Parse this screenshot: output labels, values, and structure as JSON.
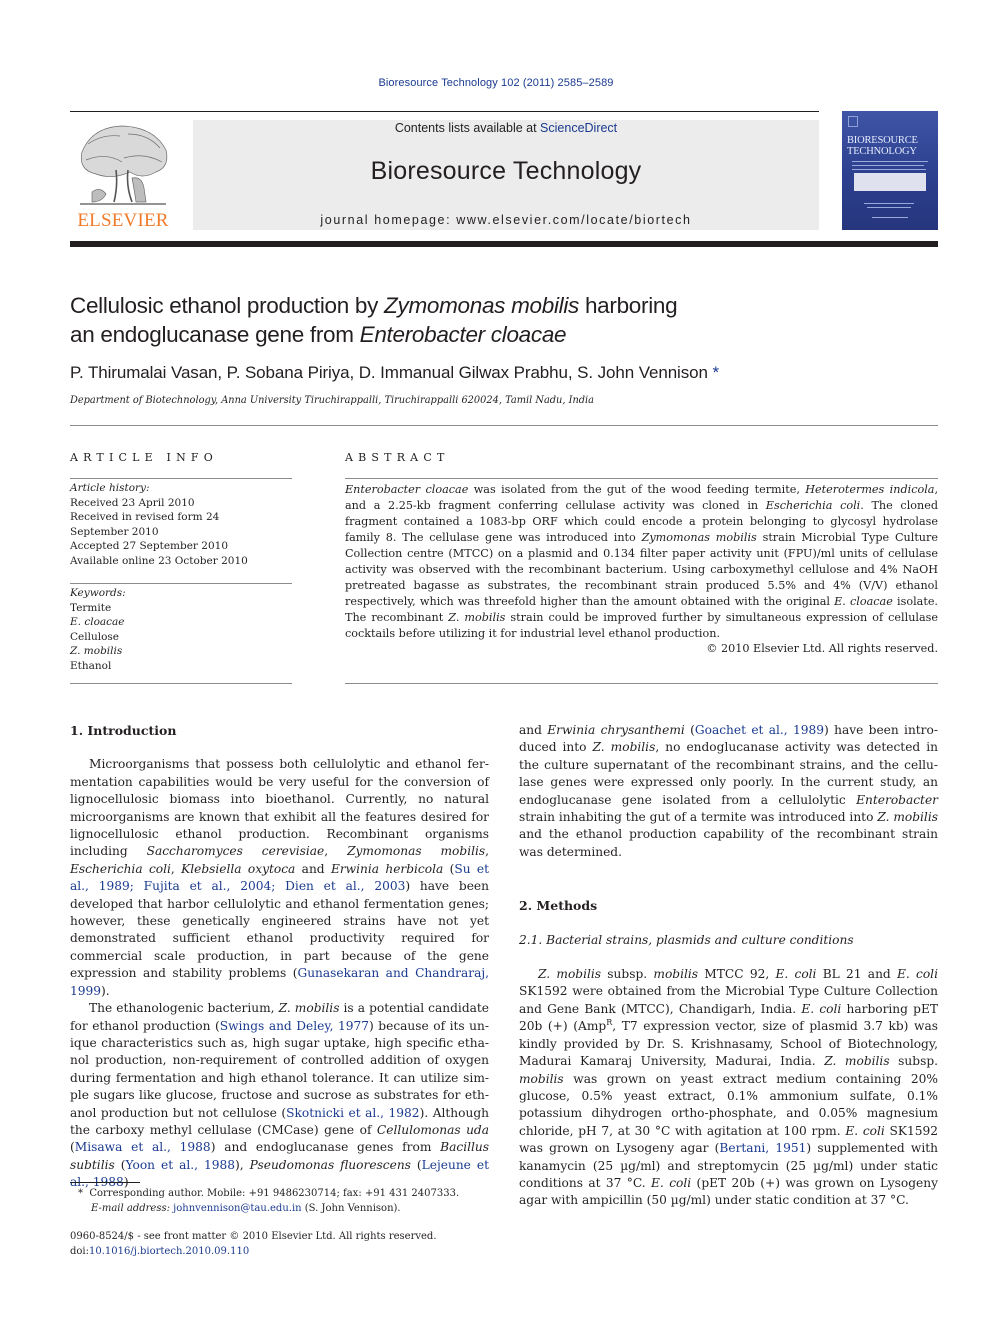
{
  "header": {
    "citation": "Bioresource Technology 102 (2011) 2585–2589",
    "contents_prefix": "Contents lists available at ",
    "contents_link": "ScienceDirect",
    "journal_title": "Bioresource Technology",
    "homepage": "journal homepage: www.elsevier.com/locate/biortech",
    "publisher_logo_text": "ELSEVIER",
    "cover_title_line1": "BIORESOURCE",
    "cover_title_line2": "TECHNOLOGY",
    "colors": {
      "elsevier_orange": "#f07b2a",
      "link_blue": "#1a3a8f",
      "cover_blue": "#2c3f8e",
      "banner_gray": "#ececec"
    }
  },
  "article": {
    "title_part1": "Cellulosic ethanol production by ",
    "title_italic1": "Zymomonas mobilis",
    "title_part2": " harboring",
    "title_line2_part1": "an endoglucanase gene from ",
    "title_italic2": "Enterobacter cloacae",
    "authors": "P. Thirumalai Vasan, P. Sobana Piriya, D. Immanual Gilwax Prabhu, S. John Vennison",
    "author_marker": "*",
    "affiliation": "Department of Biotechnology, Anna University Tiruchirappalli, Tiruchirappalli 620024, Tamil Nadu, India"
  },
  "article_info": {
    "heading": "ARTICLE INFO",
    "history_label": "Article history:",
    "history": [
      "Received 23 April 2010",
      "Received in revised form 24 September 2010",
      "Accepted 27 September 2010",
      "Available online 23 October 2010"
    ],
    "keywords_label": "Keywords:",
    "keywords": [
      {
        "text": "Termite",
        "italic": false
      },
      {
        "text": "E. cloacae",
        "italic": true
      },
      {
        "text": "Cellulose",
        "italic": false
      },
      {
        "text": "Z. mobilis",
        "italic": true
      },
      {
        "text": "Ethanol",
        "italic": false
      }
    ]
  },
  "abstract": {
    "heading": "ABSTRACT",
    "segments": [
      {
        "t": "Enterobacter cloacae",
        "i": true
      },
      {
        "t": " was isolated from the gut of the wood feeding termite, "
      },
      {
        "t": "Heterotermes indicola",
        "i": true
      },
      {
        "t": ", and a 2.25-kb fragment conferring cellulase activity was cloned in "
      },
      {
        "t": "Escherichia coli",
        "i": true
      },
      {
        "t": ". The cloned fragment con­tained a 1083-bp ORF which could encode a protein belonging to glycosyl hydrolase family 8. The cellu­lase gene was introduced into "
      },
      {
        "t": "Zymomonas mobilis",
        "i": true
      },
      {
        "t": " strain Microbial Type Culture Collection centre (MTCC) on a plasmid and 0.134 filter paper activity unit (FPU)/ml units of cellulase activity was observed with the recombinant bacterium. Using carboxymethyl cellulose and 4% NaOH pretreated bagasse as substrates, the recombinant strain produced 5.5% and 4% (V/V) ethanol respectively, which was threefold higher than the amount obtained with the original "
      },
      {
        "t": "E. cloacae",
        "i": true
      },
      {
        "t": " isolate. The recombinant "
      },
      {
        "t": "Z. mobilis",
        "i": true
      },
      {
        "t": " strain could be improved further by simultaneous expression of cellulase cocktails before utilizing it for industrial level ethanol production."
      }
    ],
    "copyright": "© 2010 Elsevier Ltd. All rights reserved."
  },
  "body": {
    "intro_heading": "1. Introduction",
    "intro_p1": [
      {
        "t": "Microorganisms that possess both cellulolytic and ethanol fer­mentation capabilities would be very useful for the conversion of lignocellulosic biomass into bioethanol. Currently, no natural microorganisms are known that exhibit all the features desired for lignocellulosic ethanol production. Recombinant organisms including "
      },
      {
        "t": "Saccharomyces cerevisiae",
        "i": true
      },
      {
        "t": ", "
      },
      {
        "t": "Zymomonas mobilis",
        "i": true
      },
      {
        "t": ", "
      },
      {
        "t": "Escherichia coli",
        "i": true
      },
      {
        "t": ", "
      },
      {
        "t": "Klebsiella oxytoca",
        "i": true
      },
      {
        "t": " and "
      },
      {
        "t": "Erwinia herbicola",
        "i": true
      },
      {
        "t": " ("
      },
      {
        "t": "Su et al., 1989; Fujita et al., 2004; Dien et al., 2003",
        "l": true
      },
      {
        "t": ") have been developed that harbor cel­lulolytic and ethanol fermentation genes; however, these geneti­cally engineered strains have not yet demonstrated sufficient ethanol productivity required for commercial scale production, in part because of the gene expression and stability problems ("
      },
      {
        "t": "Gun­asekaran and Chandraraj, 1999",
        "l": true
      },
      {
        "t": ")."
      }
    ],
    "intro_p2": [
      {
        "t": "The ethanologenic bacterium, "
      },
      {
        "t": "Z. mobilis",
        "i": true
      },
      {
        "t": " is a potential candidate for ethanol production ("
      },
      {
        "t": "Swings and Deley, 1977",
        "l": true
      },
      {
        "t": ") because of its un­ique characteristics such as, high sugar uptake, high specific etha­nol production, non-requirement of controlled addition of oxygen during fermentation and high ethanol tolerance. It can utilize sim­ple sugars like glucose, fructose and sucrose as substrates for eth­anol production but not cellulose ("
      },
      {
        "t": "Skotnicki et al., 1982",
        "l": true
      },
      {
        "t": "). Although the carboxy methyl cellulase (CMCase) gene of "
      },
      {
        "t": "Cellulomonas uda",
        "i": true
      },
      {
        "t": " ("
      },
      {
        "t": "Misawa et al., 1988",
        "l": true
      },
      {
        "t": ") and endoglucanase genes from "
      },
      {
        "t": "Bacillus subtil­is",
        "i": true
      },
      {
        "t": " ("
      },
      {
        "t": "Yoon et al., 1988",
        "l": true
      },
      {
        "t": "), "
      },
      {
        "t": "Pseudomonas fluorescens",
        "i": true
      },
      {
        "t": " ("
      },
      {
        "t": "Lejeune et al., 1988",
        "l": true
      },
      {
        "t": ") and "
      },
      {
        "t": "Erwinia chrysanthemi",
        "i": true
      },
      {
        "t": " ("
      },
      {
        "t": "Goachet et al., 1989",
        "l": true
      },
      {
        "t": ") have been intro­duced into "
      },
      {
        "t": "Z. mobilis",
        "i": true
      },
      {
        "t": ", no endoglucanase activity was detected in the culture supernatant of the recombinant strains, and the cellu­lase genes were expressed only poorly. In the current study, an endoglucanase gene isolated from a cellulolytic "
      },
      {
        "t": "Enterobacter",
        "i": true
      },
      {
        "t": " strain inhabiting the gut of a termite was introduced into "
      },
      {
        "t": "Z. mobilis",
        "i": true
      },
      {
        "t": " and the ethanol production capability of the recombinant strain was determined."
      }
    ],
    "methods_heading": "2. Methods",
    "methods_sub_heading": "2.1. Bacterial strains, plasmids and culture conditions",
    "methods_p1": [
      {
        "t": "Z. mobilis",
        "i": true
      },
      {
        "t": " subsp. "
      },
      {
        "t": "mobilis",
        "i": true
      },
      {
        "t": " MTCC 92, "
      },
      {
        "t": "E. coli",
        "i": true
      },
      {
        "t": " BL 21 and "
      },
      {
        "t": "E. coli",
        "i": true
      },
      {
        "t": " SK1592 were obtained from the Microbial Type Culture Collection and Gene Bank (MTCC), Chandigarh, India. "
      },
      {
        "t": "E. coli",
        "i": true
      },
      {
        "t": " harboring pET 20b (+) (Amp"
      },
      {
        "t": "R",
        "s": true
      },
      {
        "t": ", T7 expression vector, size of plasmid 3.7 kb) was kindly provided by Dr. S. Krishnasamy, School of Biotechnology, Madurai Kamaraj University, Madurai, India. "
      },
      {
        "t": "Z. mobilis",
        "i": true
      },
      {
        "t": " subsp. "
      },
      {
        "t": "mobilis",
        "i": true
      },
      {
        "t": " was grown on yeast extract medium containing 20% glucose, 0.5% yeast extract, 0.1% ammonium sulfate, 0.1% potassium dihydrogen ortho-phosphate, and 0.05% magnesium chloride, pH 7, at 30 °C with agitation at 100 rpm. "
      },
      {
        "t": "E. coli",
        "i": true
      },
      {
        "t": " SK1592 was grown on Lysogeny agar ("
      },
      {
        "t": "Bertani, 1951",
        "l": true
      },
      {
        "t": ") supplemented with kanamycin (25 µg/ml) and streptomycin (25 µg/ml) under static conditions at 37 °C. "
      },
      {
        "t": "E. coli",
        "i": true
      },
      {
        "t": " (pET 20b (+) was grown on Lysogeny agar with ampicillin (50 µg/ml) under static condition at 37 °C."
      }
    ]
  },
  "footnotes": {
    "marker": "*",
    "corresponding": "Corresponding author. Mobile: +91 9486230714; fax: +91 431 2407333.",
    "email_label": "E-mail address:",
    "email": "johnvennison@tau.edu.in",
    "email_suffix": " (S. John Vennison).",
    "issn": "0960-8524/$ - see front matter © 2010 Elsevier Ltd. All rights reserved.",
    "doi_prefix": "doi:",
    "doi": "10.1016/j.biortech.2010.09.110"
  }
}
